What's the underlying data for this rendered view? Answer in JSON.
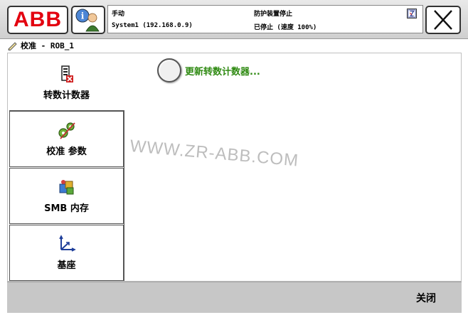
{
  "header": {
    "logo_text": "ABB",
    "mode": "手动",
    "system": "System1 (192.168.0.9)",
    "safety": "防护装置停止",
    "state": "已停止 (速度 100%)"
  },
  "window": {
    "title": "校准 - ROB_1"
  },
  "nav": {
    "items": [
      {
        "label": "转数计数器",
        "icon": "revolution-counter-icon"
      },
      {
        "label": "校准 参数",
        "icon": "calibration-gears-icon"
      },
      {
        "label": "SMB 内存",
        "icon": "smb-memory-icon"
      },
      {
        "label": "基座",
        "icon": "base-frame-icon"
      }
    ]
  },
  "main": {
    "progress_message": "更新转数计数器...",
    "watermark": "WWW.ZR-ABB.COM"
  },
  "footer": {
    "close_label": "关闭"
  },
  "colors": {
    "logo_red": "#e3000f",
    "message_green": "#2f8a12"
  }
}
